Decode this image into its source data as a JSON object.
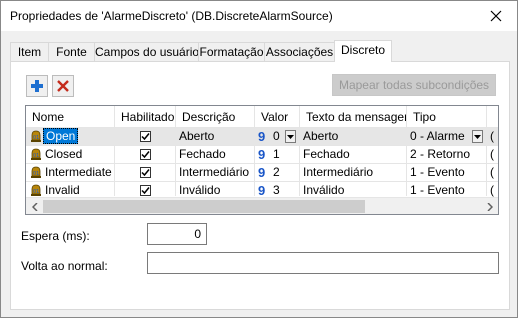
{
  "window": {
    "title": "Propriedades de 'AlarmeDiscreto' (DB.DiscreteAlarmSource)",
    "close_icon": "close-icon"
  },
  "tabs": [
    {
      "label": "Item"
    },
    {
      "label": "Fonte"
    },
    {
      "label": "Campos do usuário"
    },
    {
      "label": "Formatação"
    },
    {
      "label": "Associações"
    },
    {
      "label": "Discreto",
      "active": true
    }
  ],
  "toolbar": {
    "add_icon": "plus-icon",
    "delete_icon": "delete-x-icon",
    "map_button": "Mapear todas subcondições",
    "map_button_enabled": false
  },
  "grid": {
    "columns": [
      "Nome",
      "Habilitado",
      "Descrição",
      "Valor",
      "Texto da mensagem",
      "Tipo"
    ],
    "rows": [
      {
        "name": "Open",
        "enabled": true,
        "description": "Aberto",
        "priority_glyph": "9",
        "value": "0",
        "message": "Aberto",
        "type": "0 - Alarme",
        "extra": "(",
        "selected": true
      },
      {
        "name": "Closed",
        "enabled": true,
        "description": "Fechado",
        "priority_glyph": "9",
        "value": "1",
        "message": "Fechado",
        "type": "2 - Retorno",
        "extra": "("
      },
      {
        "name": "Intermediate",
        "enabled": true,
        "description": "Intermediário",
        "priority_glyph": "9",
        "value": "2",
        "message": "Intermediário",
        "type": "1 - Evento",
        "extra": "("
      },
      {
        "name": "Invalid",
        "enabled": true,
        "description": "Inválido",
        "priority_glyph": "9",
        "value": "3",
        "message": "Inválido",
        "type": "1 - Evento",
        "extra": "("
      }
    ]
  },
  "form": {
    "wait_label": "Espera (ms):",
    "wait_value": "0",
    "return_label": "Volta ao normal:",
    "return_value": ""
  },
  "colors": {
    "accent": "#0078d7",
    "priority_blue": "#1a56c8",
    "disabled_text": "#9a9a9a"
  }
}
